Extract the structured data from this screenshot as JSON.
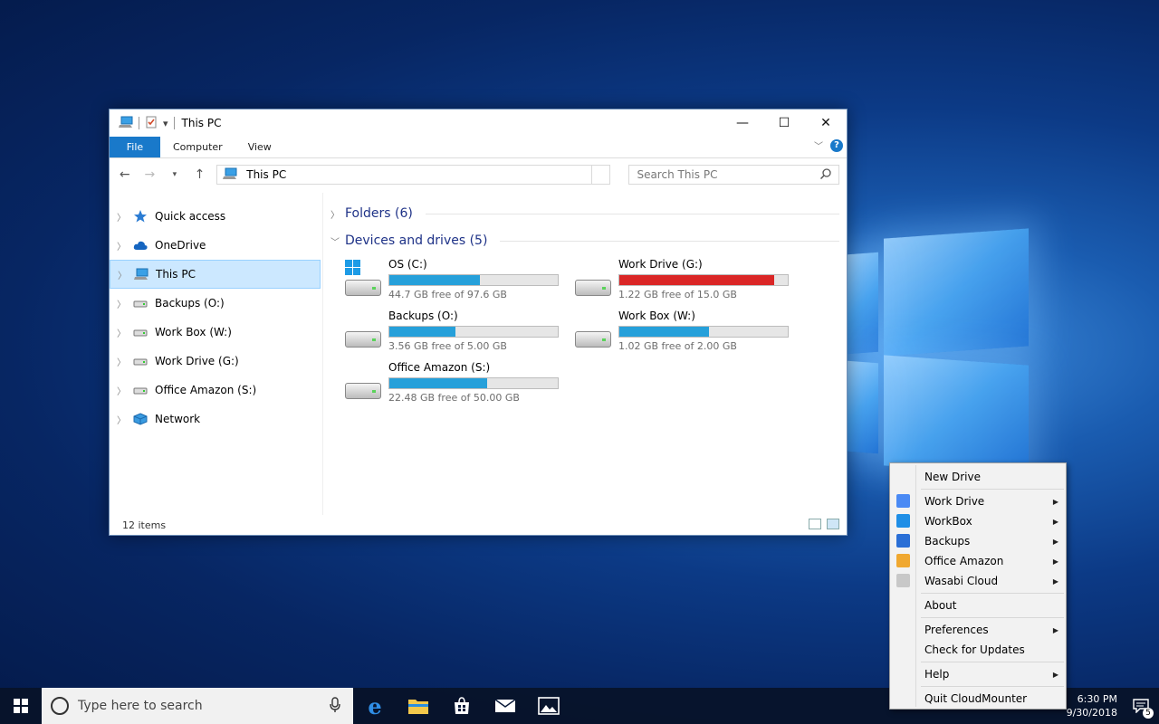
{
  "explorer": {
    "title": "This PC",
    "ribbon_tabs": [
      "File",
      "Computer",
      "View"
    ],
    "address": "This PC",
    "search_placeholder": "Search This PC",
    "nav_items": [
      {
        "label": "Quick access",
        "icon": "star-icon"
      },
      {
        "label": "OneDrive",
        "icon": "cloud-icon"
      },
      {
        "label": "This PC",
        "icon": "computer-icon",
        "selected": true
      },
      {
        "label": "Backups (O:)",
        "icon": "drive-icon"
      },
      {
        "label": "Work Box (W:)",
        "icon": "drive-icon"
      },
      {
        "label": "Work Drive (G:)",
        "icon": "drive-icon"
      },
      {
        "label": "Office Amazon (S:)",
        "icon": "drive-icon"
      },
      {
        "label": "Network",
        "icon": "network-icon"
      }
    ],
    "groups": {
      "folders": "Folders (6)",
      "devices": "Devices and drives (5)"
    },
    "drives": [
      {
        "name": "OS (C:)",
        "free": "44.7 GB free of 97.6 GB",
        "used_fraction": 0.54,
        "critical": false,
        "os": true
      },
      {
        "name": "Work Drive (G:)",
        "free": "1.22 GB free of 15.0 GB",
        "used_fraction": 0.92,
        "critical": true,
        "os": false
      },
      {
        "name": "Backups (O:)",
        "free": "3.56 GB free of 5.00 GB",
        "used_fraction": 0.39,
        "critical": false,
        "os": false
      },
      {
        "name": "Work Box (W:)",
        "free": "1.02 GB free of 2.00 GB",
        "used_fraction": 0.53,
        "critical": false,
        "os": false
      },
      {
        "name": "Office Amazon (S:)",
        "free": "22.48 GB free of 50.00 GB",
        "used_fraction": 0.58,
        "critical": false,
        "os": false
      }
    ],
    "status": "12 items"
  },
  "taskbar": {
    "search_placeholder": "Type here to search",
    "time": "6:30 PM",
    "date": "9/30/2018",
    "notification_count": "5"
  },
  "menu": {
    "items": [
      {
        "label": "New Drive",
        "submenu": false,
        "icon": null
      },
      {
        "sep": true
      },
      {
        "label": "Work Drive",
        "submenu": true,
        "icon": "google-drive-icon",
        "color": "#4a8af4"
      },
      {
        "label": "WorkBox",
        "submenu": true,
        "icon": "box-icon",
        "color": "#1f8ee6"
      },
      {
        "label": "Backups",
        "submenu": true,
        "icon": "backups-icon",
        "color": "#2a6fd6"
      },
      {
        "label": "Office Amazon",
        "submenu": true,
        "icon": "amazon-icon",
        "color": "#f0a830"
      },
      {
        "label": "Wasabi Cloud",
        "submenu": true,
        "icon": "wasabi-icon",
        "color": "#c8c8c8"
      },
      {
        "sep": true
      },
      {
        "label": "About",
        "submenu": false,
        "icon": null
      },
      {
        "sep": true
      },
      {
        "label": "Preferences",
        "submenu": true,
        "icon": null
      },
      {
        "label": "Check for Updates",
        "submenu": false,
        "icon": null
      },
      {
        "sep": true
      },
      {
        "label": "Help",
        "submenu": true,
        "icon": null
      },
      {
        "sep": true
      },
      {
        "label": "Quit CloudMounter",
        "submenu": false,
        "icon": null
      }
    ]
  }
}
